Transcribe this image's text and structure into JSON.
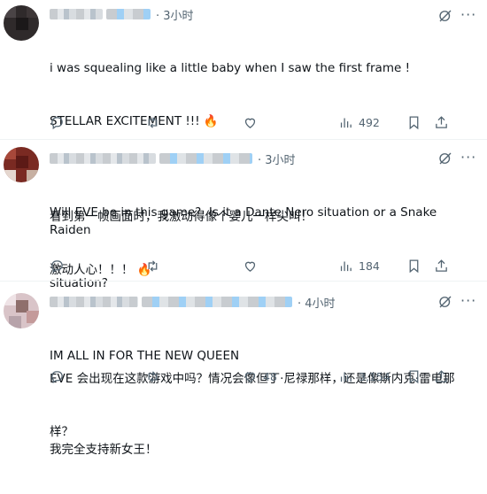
{
  "tweets": [
    {
      "time": "· 3小时",
      "lines": [
        "i was squealing like a little baby when I saw the first frame !",
        "STELLAR EXCITEMENT !!! 🔥",
        "",
        "看到第一帧画面时，我激动得像个婴儿一样尖叫！",
        "激动人心！！！ 🔥"
      ],
      "likes": "",
      "views": "492"
    },
    {
      "time": "· 3小时",
      "lines": [
        "Will EVE be in this game?  Is it a Dante Nero situation or a Snake Raiden",
        "situation?",
        "",
        "EVE 会出现在这款游戏中吗？情况会像但丁·尼禄那样，还是像斯内克·雷电那",
        "样？"
      ],
      "likes": "",
      "views": "184"
    },
    {
      "time": "· 4小时",
      "lines": [
        "IM ALL IN FOR THE NEW QUEEN",
        "",
        "我完全支持新女王！"
      ],
      "likes": "48",
      "views": "3,154"
    }
  ],
  "icons": {
    "reply": "reply-icon",
    "retweet": "retweet-icon",
    "like": "heart-icon",
    "views": "views-icon",
    "bookmark": "bookmark-icon",
    "share": "share-icon",
    "grok": "grok-icon",
    "more": "more-icon"
  },
  "colors": {
    "text": "#0f1419",
    "muted": "#536471",
    "divider": "#eff3f4"
  }
}
